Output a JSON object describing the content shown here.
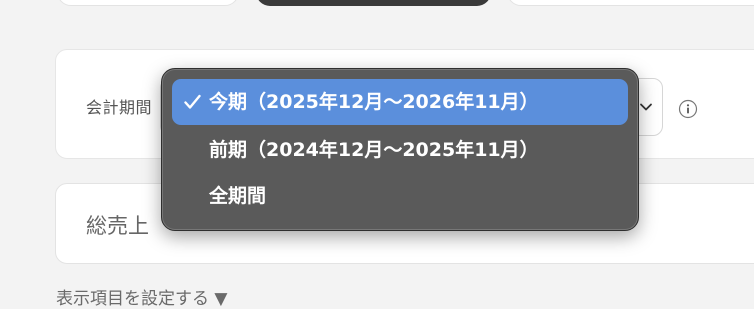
{
  "period": {
    "label": "会計期間",
    "info_icon": "info-icon",
    "chevron_icon": "chevron-down-icon",
    "menu": {
      "check_icon": "checkmark-icon",
      "options": [
        {
          "label": "今期（2025年12月〜2026年11月）",
          "selected": true
        },
        {
          "label": "前期（2024年12月〜2025年11月）",
          "selected": false
        },
        {
          "label": "全期間",
          "selected": false
        }
      ]
    }
  },
  "sales": {
    "label": "総売上"
  },
  "settings_link": "表示項目を設定する ▼",
  "colors": {
    "menu_background": "#5a5a5a",
    "menu_selected": "#5b8fdc",
    "page_background": "#f3f3f3"
  }
}
